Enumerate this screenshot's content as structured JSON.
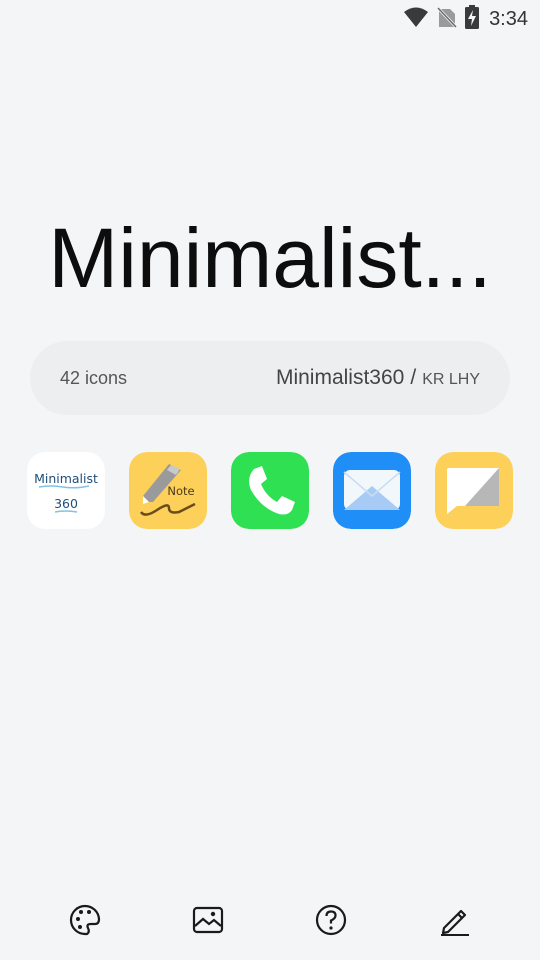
{
  "status_bar": {
    "time": "3:34",
    "icons": [
      "wifi-icon",
      "no-sim-icon",
      "battery-charging-icon"
    ]
  },
  "pack": {
    "title": "Minimalist...",
    "icon_count": "42 icons",
    "name": "Minimalist360",
    "separator": "/",
    "author": "KR LHY"
  },
  "preview_icons": [
    {
      "name": "minimalist360-app-icon",
      "line1": "Minimalist",
      "line2": "360"
    },
    {
      "name": "note-app-icon",
      "label": "Note"
    },
    {
      "name": "phone-app-icon"
    },
    {
      "name": "mail-app-icon"
    },
    {
      "name": "messages-app-icon"
    }
  ],
  "bottom_nav": [
    "palette-icon",
    "wallpaper-icon",
    "help-icon",
    "edit-icon"
  ],
  "colors": {
    "background": "#f4f5f7",
    "pill": "#eceef0",
    "note_yellow": "#fdd05a",
    "phone_green": "#2ee052",
    "mail_blue": "#1f8ef7",
    "message_yellow": "#fdd05a"
  }
}
